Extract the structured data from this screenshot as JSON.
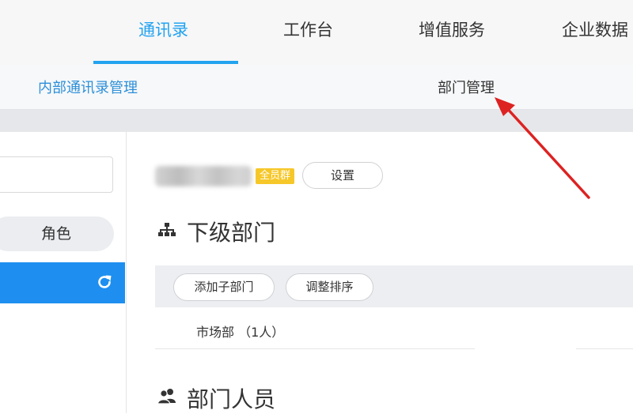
{
  "nav": {
    "tabs": [
      {
        "label": "通讯录",
        "active": true
      },
      {
        "label": "工作台"
      },
      {
        "label": "增值服务"
      },
      {
        "label": "企业数据"
      }
    ]
  },
  "subnav": {
    "internal": "内部通讯录管理",
    "dept_mgmt": "部门管理"
  },
  "sidebar": {
    "role_label": "角色",
    "refresh_icon": "refresh-icon"
  },
  "main": {
    "badge": "全员群",
    "settings_button": "设置",
    "sub_dept_title": "下级部门",
    "add_sub_dept_button": "添加子部门",
    "adjust_order_button": "调整排序",
    "dept_rows": [
      {
        "name": "市场部",
        "count": "（1人）"
      }
    ],
    "members_title": "部门人员"
  },
  "colors": {
    "accent": "#23a3ef",
    "selected_row": "#1e8ff0",
    "badge": "#f6c728",
    "arrow": "#dd2222"
  }
}
